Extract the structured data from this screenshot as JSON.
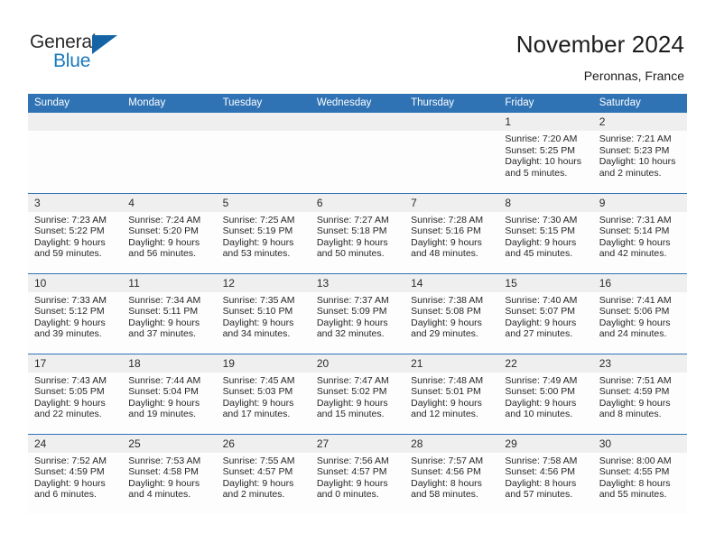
{
  "brand": {
    "name_part1": "General",
    "name_part2": "Blue",
    "triangle_color": "#1464a5",
    "blue_text_color": "#1878be"
  },
  "header": {
    "title": "November 2024",
    "subtitle": "Peronnas, France",
    "accent_color": "#3073b5",
    "daynum_band_color": "#efefef"
  },
  "weekdays": [
    "Sunday",
    "Monday",
    "Tuesday",
    "Wednesday",
    "Thursday",
    "Friday",
    "Saturday"
  ],
  "labels": {
    "sunrise_prefix": "Sunrise:",
    "sunset_prefix": "Sunset:",
    "daylight_prefix": "Daylight:"
  },
  "weeks": [
    [
      {
        "day": "",
        "empty": true
      },
      {
        "day": "",
        "empty": true
      },
      {
        "day": "",
        "empty": true
      },
      {
        "day": "",
        "empty": true
      },
      {
        "day": "",
        "empty": true
      },
      {
        "day": "1",
        "sunrise": "Sunrise: 7:20 AM",
        "sunset": "Sunset: 5:25 PM",
        "daylight_l1": "Daylight: 10 hours",
        "daylight_l2": "and 5 minutes."
      },
      {
        "day": "2",
        "sunrise": "Sunrise: 7:21 AM",
        "sunset": "Sunset: 5:23 PM",
        "daylight_l1": "Daylight: 10 hours",
        "daylight_l2": "and 2 minutes."
      }
    ],
    [
      {
        "day": "3",
        "sunrise": "Sunrise: 7:23 AM",
        "sunset": "Sunset: 5:22 PM",
        "daylight_l1": "Daylight: 9 hours",
        "daylight_l2": "and 59 minutes."
      },
      {
        "day": "4",
        "sunrise": "Sunrise: 7:24 AM",
        "sunset": "Sunset: 5:20 PM",
        "daylight_l1": "Daylight: 9 hours",
        "daylight_l2": "and 56 minutes."
      },
      {
        "day": "5",
        "sunrise": "Sunrise: 7:25 AM",
        "sunset": "Sunset: 5:19 PM",
        "daylight_l1": "Daylight: 9 hours",
        "daylight_l2": "and 53 minutes."
      },
      {
        "day": "6",
        "sunrise": "Sunrise: 7:27 AM",
        "sunset": "Sunset: 5:18 PM",
        "daylight_l1": "Daylight: 9 hours",
        "daylight_l2": "and 50 minutes."
      },
      {
        "day": "7",
        "sunrise": "Sunrise: 7:28 AM",
        "sunset": "Sunset: 5:16 PM",
        "daylight_l1": "Daylight: 9 hours",
        "daylight_l2": "and 48 minutes."
      },
      {
        "day": "8",
        "sunrise": "Sunrise: 7:30 AM",
        "sunset": "Sunset: 5:15 PM",
        "daylight_l1": "Daylight: 9 hours",
        "daylight_l2": "and 45 minutes."
      },
      {
        "day": "9",
        "sunrise": "Sunrise: 7:31 AM",
        "sunset": "Sunset: 5:14 PM",
        "daylight_l1": "Daylight: 9 hours",
        "daylight_l2": "and 42 minutes."
      }
    ],
    [
      {
        "day": "10",
        "sunrise": "Sunrise: 7:33 AM",
        "sunset": "Sunset: 5:12 PM",
        "daylight_l1": "Daylight: 9 hours",
        "daylight_l2": "and 39 minutes."
      },
      {
        "day": "11",
        "sunrise": "Sunrise: 7:34 AM",
        "sunset": "Sunset: 5:11 PM",
        "daylight_l1": "Daylight: 9 hours",
        "daylight_l2": "and 37 minutes."
      },
      {
        "day": "12",
        "sunrise": "Sunrise: 7:35 AM",
        "sunset": "Sunset: 5:10 PM",
        "daylight_l1": "Daylight: 9 hours",
        "daylight_l2": "and 34 minutes."
      },
      {
        "day": "13",
        "sunrise": "Sunrise: 7:37 AM",
        "sunset": "Sunset: 5:09 PM",
        "daylight_l1": "Daylight: 9 hours",
        "daylight_l2": "and 32 minutes."
      },
      {
        "day": "14",
        "sunrise": "Sunrise: 7:38 AM",
        "sunset": "Sunset: 5:08 PM",
        "daylight_l1": "Daylight: 9 hours",
        "daylight_l2": "and 29 minutes."
      },
      {
        "day": "15",
        "sunrise": "Sunrise: 7:40 AM",
        "sunset": "Sunset: 5:07 PM",
        "daylight_l1": "Daylight: 9 hours",
        "daylight_l2": "and 27 minutes."
      },
      {
        "day": "16",
        "sunrise": "Sunrise: 7:41 AM",
        "sunset": "Sunset: 5:06 PM",
        "daylight_l1": "Daylight: 9 hours",
        "daylight_l2": "and 24 minutes."
      }
    ],
    [
      {
        "day": "17",
        "sunrise": "Sunrise: 7:43 AM",
        "sunset": "Sunset: 5:05 PM",
        "daylight_l1": "Daylight: 9 hours",
        "daylight_l2": "and 22 minutes."
      },
      {
        "day": "18",
        "sunrise": "Sunrise: 7:44 AM",
        "sunset": "Sunset: 5:04 PM",
        "daylight_l1": "Daylight: 9 hours",
        "daylight_l2": "and 19 minutes."
      },
      {
        "day": "19",
        "sunrise": "Sunrise: 7:45 AM",
        "sunset": "Sunset: 5:03 PM",
        "daylight_l1": "Daylight: 9 hours",
        "daylight_l2": "and 17 minutes."
      },
      {
        "day": "20",
        "sunrise": "Sunrise: 7:47 AM",
        "sunset": "Sunset: 5:02 PM",
        "daylight_l1": "Daylight: 9 hours",
        "daylight_l2": "and 15 minutes."
      },
      {
        "day": "21",
        "sunrise": "Sunrise: 7:48 AM",
        "sunset": "Sunset: 5:01 PM",
        "daylight_l1": "Daylight: 9 hours",
        "daylight_l2": "and 12 minutes."
      },
      {
        "day": "22",
        "sunrise": "Sunrise: 7:49 AM",
        "sunset": "Sunset: 5:00 PM",
        "daylight_l1": "Daylight: 9 hours",
        "daylight_l2": "and 10 minutes."
      },
      {
        "day": "23",
        "sunrise": "Sunrise: 7:51 AM",
        "sunset": "Sunset: 4:59 PM",
        "daylight_l1": "Daylight: 9 hours",
        "daylight_l2": "and 8 minutes."
      }
    ],
    [
      {
        "day": "24",
        "sunrise": "Sunrise: 7:52 AM",
        "sunset": "Sunset: 4:59 PM",
        "daylight_l1": "Daylight: 9 hours",
        "daylight_l2": "and 6 minutes."
      },
      {
        "day": "25",
        "sunrise": "Sunrise: 7:53 AM",
        "sunset": "Sunset: 4:58 PM",
        "daylight_l1": "Daylight: 9 hours",
        "daylight_l2": "and 4 minutes."
      },
      {
        "day": "26",
        "sunrise": "Sunrise: 7:55 AM",
        "sunset": "Sunset: 4:57 PM",
        "daylight_l1": "Daylight: 9 hours",
        "daylight_l2": "and 2 minutes."
      },
      {
        "day": "27",
        "sunrise": "Sunrise: 7:56 AM",
        "sunset": "Sunset: 4:57 PM",
        "daylight_l1": "Daylight: 9 hours",
        "daylight_l2": "and 0 minutes."
      },
      {
        "day": "28",
        "sunrise": "Sunrise: 7:57 AM",
        "sunset": "Sunset: 4:56 PM",
        "daylight_l1": "Daylight: 8 hours",
        "daylight_l2": "and 58 minutes."
      },
      {
        "day": "29",
        "sunrise": "Sunrise: 7:58 AM",
        "sunset": "Sunset: 4:56 PM",
        "daylight_l1": "Daylight: 8 hours",
        "daylight_l2": "and 57 minutes."
      },
      {
        "day": "30",
        "sunrise": "Sunrise: 8:00 AM",
        "sunset": "Sunset: 4:55 PM",
        "daylight_l1": "Daylight: 8 hours",
        "daylight_l2": "and 55 minutes."
      }
    ]
  ]
}
